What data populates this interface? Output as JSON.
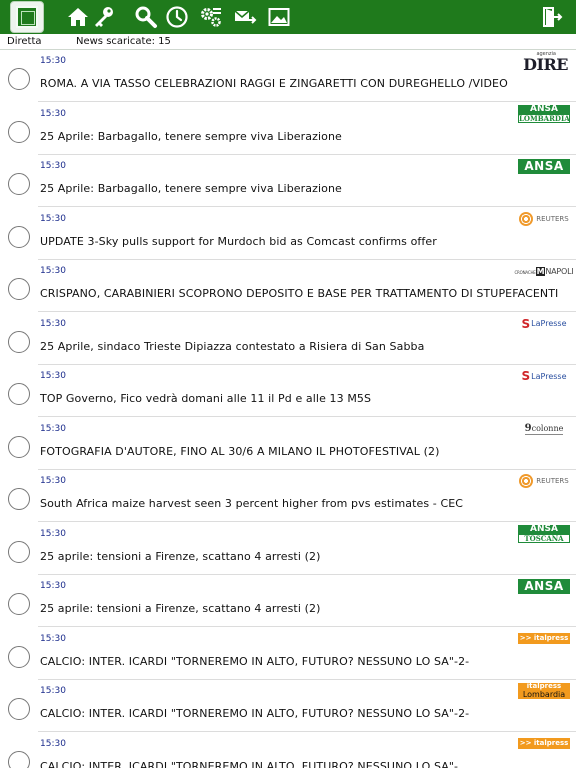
{
  "toolbar": {
    "icons": [
      "app-icon",
      "home-icon",
      "key-icon",
      "search-icon",
      "clock-icon",
      "settings-icon",
      "mail-forward-icon",
      "image-icon",
      "logout-icon"
    ]
  },
  "status": {
    "mode": "Diretta",
    "count_text": "News scaricate: 15"
  },
  "news": [
    {
      "time": "15:30",
      "title": "ROMA. A VIA TASSO CELEBRAZIONI RAGGI E ZINGARETTI CON DUREGHELLO /VIDEO",
      "source": "dire",
      "logo_text": [
        "agenzia",
        "DIRE"
      ]
    },
    {
      "time": "15:30",
      "title": "25 Aprile: Barbagallo, tenere sempre viva Liberazione",
      "source": "ansa-region",
      "logo_text": [
        "ANSA",
        "LOMBARDIA"
      ]
    },
    {
      "time": "15:30",
      "title": "25 Aprile: Barbagallo, tenere sempre viva Liberazione",
      "source": "ansa",
      "logo_text": [
        "ANSA"
      ]
    },
    {
      "time": "15:30",
      "title": "UPDATE 3-Sky pulls support for Murdoch bid as Comcast confirms offer",
      "source": "reuters",
      "logo_text": [
        "REUTERS"
      ]
    },
    {
      "time": "15:30",
      "title": "CRISPANO, CARABINIERI SCOPRONO DEPOSITO E BASE PER TRATTAMENTO DI STUPEFACENTI",
      "source": "napoli",
      "logo_text": [
        "CRONACHE",
        "NAPOLI"
      ]
    },
    {
      "time": "15:30",
      "title": "25 Aprile, sindaco Trieste Dipiazza contestato a Risiera di San Sabba",
      "source": "lapresse",
      "logo_text": [
        "LaPresse"
      ]
    },
    {
      "time": "15:30",
      "title": "TOP Governo, Fico vedrà domani alle 11 il Pd e alle 13 M5S",
      "source": "lapresse",
      "logo_text": [
        "LaPresse"
      ]
    },
    {
      "time": "15:30",
      "title": "FOTOGRAFIA D'AUTORE, FINO AL 30/6 A MILANO IL PHOTOFESTIVAL (2)",
      "source": "9colonne",
      "logo_text": [
        "9",
        "colonne"
      ]
    },
    {
      "time": "15:30",
      "title": "South Africa maize harvest seen 3 percent higher from pvs estimates - CEC",
      "source": "reuters",
      "logo_text": [
        "REUTERS"
      ]
    },
    {
      "time": "15:30",
      "title": "25 aprile: tensioni a Firenze, scattano 4 arresti (2)",
      "source": "ansa-region",
      "logo_text": [
        "ANSA",
        "TOSCANA"
      ]
    },
    {
      "time": "15:30",
      "title": "25 aprile: tensioni a Firenze, scattano 4 arresti (2)",
      "source": "ansa",
      "logo_text": [
        "ANSA"
      ]
    },
    {
      "time": "15:30",
      "title": "CALCIO: INTER. ICARDI \"TORNEREMO IN ALTO, FUTURO? NESSUNO LO SA\"-2-",
      "source": "italpress",
      "logo_text": [
        ">> italpress"
      ]
    },
    {
      "time": "15:30",
      "title": "CALCIO: INTER. ICARDI \"TORNEREMO IN ALTO, FUTURO? NESSUNO LO SA\"-2-",
      "source": "italpress-lomb",
      "logo_text": [
        "italpress",
        "Lombardia"
      ]
    },
    {
      "time": "15:30",
      "title": "CALCIO: INTER. ICARDI \"TORNEREMO IN ALTO, FUTURO? NESSUNO LO SA\"-",
      "source": "italpress",
      "logo_text": [
        ">> italpress"
      ]
    }
  ],
  "colors": {
    "toolbar": "#1f7a1c",
    "time": "#1c2d8c",
    "ansa": "#1f8b3a",
    "italpress": "#f29a1e"
  }
}
